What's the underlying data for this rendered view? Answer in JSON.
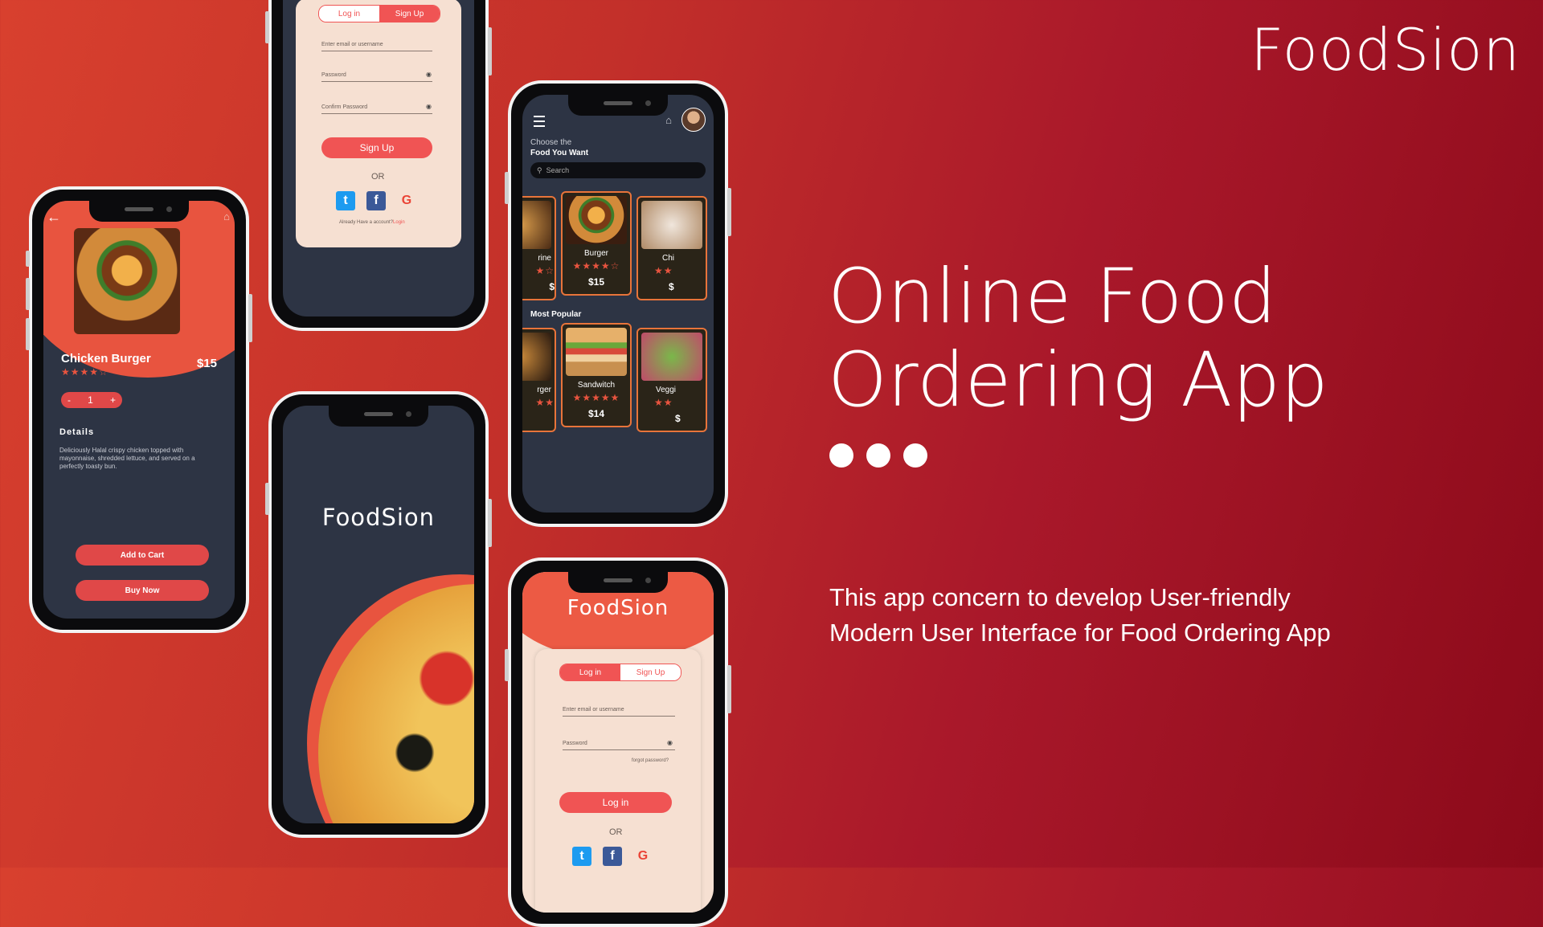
{
  "brand": "FoodSion",
  "headline": [
    "Online Food",
    "Ordering App"
  ],
  "description": [
    "This app concern to develop User-friendly",
    "Modern User Interface for Food Ordering App"
  ],
  "detail_screen": {
    "item_name": "Chicken Burger",
    "price": "$15",
    "stars": "★★★★☆",
    "stepper": {
      "minus": "-",
      "qty": "1",
      "plus": "+"
    },
    "details_heading": "Details",
    "details_text": "Deliciously Halal crispy chicken topped with mayonnaise, shredded lettuce, and served on a perfectly toasty bun.",
    "add_to_cart": "Add to Cart",
    "buy_now": "Buy Now"
  },
  "signup_screen": {
    "tab_login": "Log in",
    "tab_signup": "Sign Up",
    "email": "Enter email or username",
    "password": "Password",
    "confirm": "Confirm Password",
    "button": "Sign Up",
    "or": "OR",
    "already": "Already Have a account?",
    "login_link": "Login"
  },
  "splash_screen": {
    "title": "FoodSion"
  },
  "menu_screen": {
    "line1": "Choose the",
    "line2": "Food You Want",
    "search": "Search",
    "popular": "Most Popular",
    "row1": [
      {
        "name": "rine",
        "stars": "★☆",
        "price": "$"
      },
      {
        "name": "Burger",
        "stars": "★★★★☆",
        "price": "$15"
      },
      {
        "name": "Chi",
        "stars": "★★",
        "price": "$"
      }
    ],
    "row2": [
      {
        "name": "rger",
        "stars": "★★",
        "price": ""
      },
      {
        "name": "Sandwitch",
        "stars": "★★★★★",
        "price": "$14"
      },
      {
        "name": "Veggi",
        "stars": "★★",
        "price": "$"
      }
    ]
  },
  "login_screen": {
    "title": "FoodSion",
    "tab_login": "Log in",
    "tab_signup": "Sign Up",
    "email": "Enter email or username",
    "password": "Password",
    "forgot": "forgot password?",
    "button": "Log in",
    "or": "OR"
  }
}
